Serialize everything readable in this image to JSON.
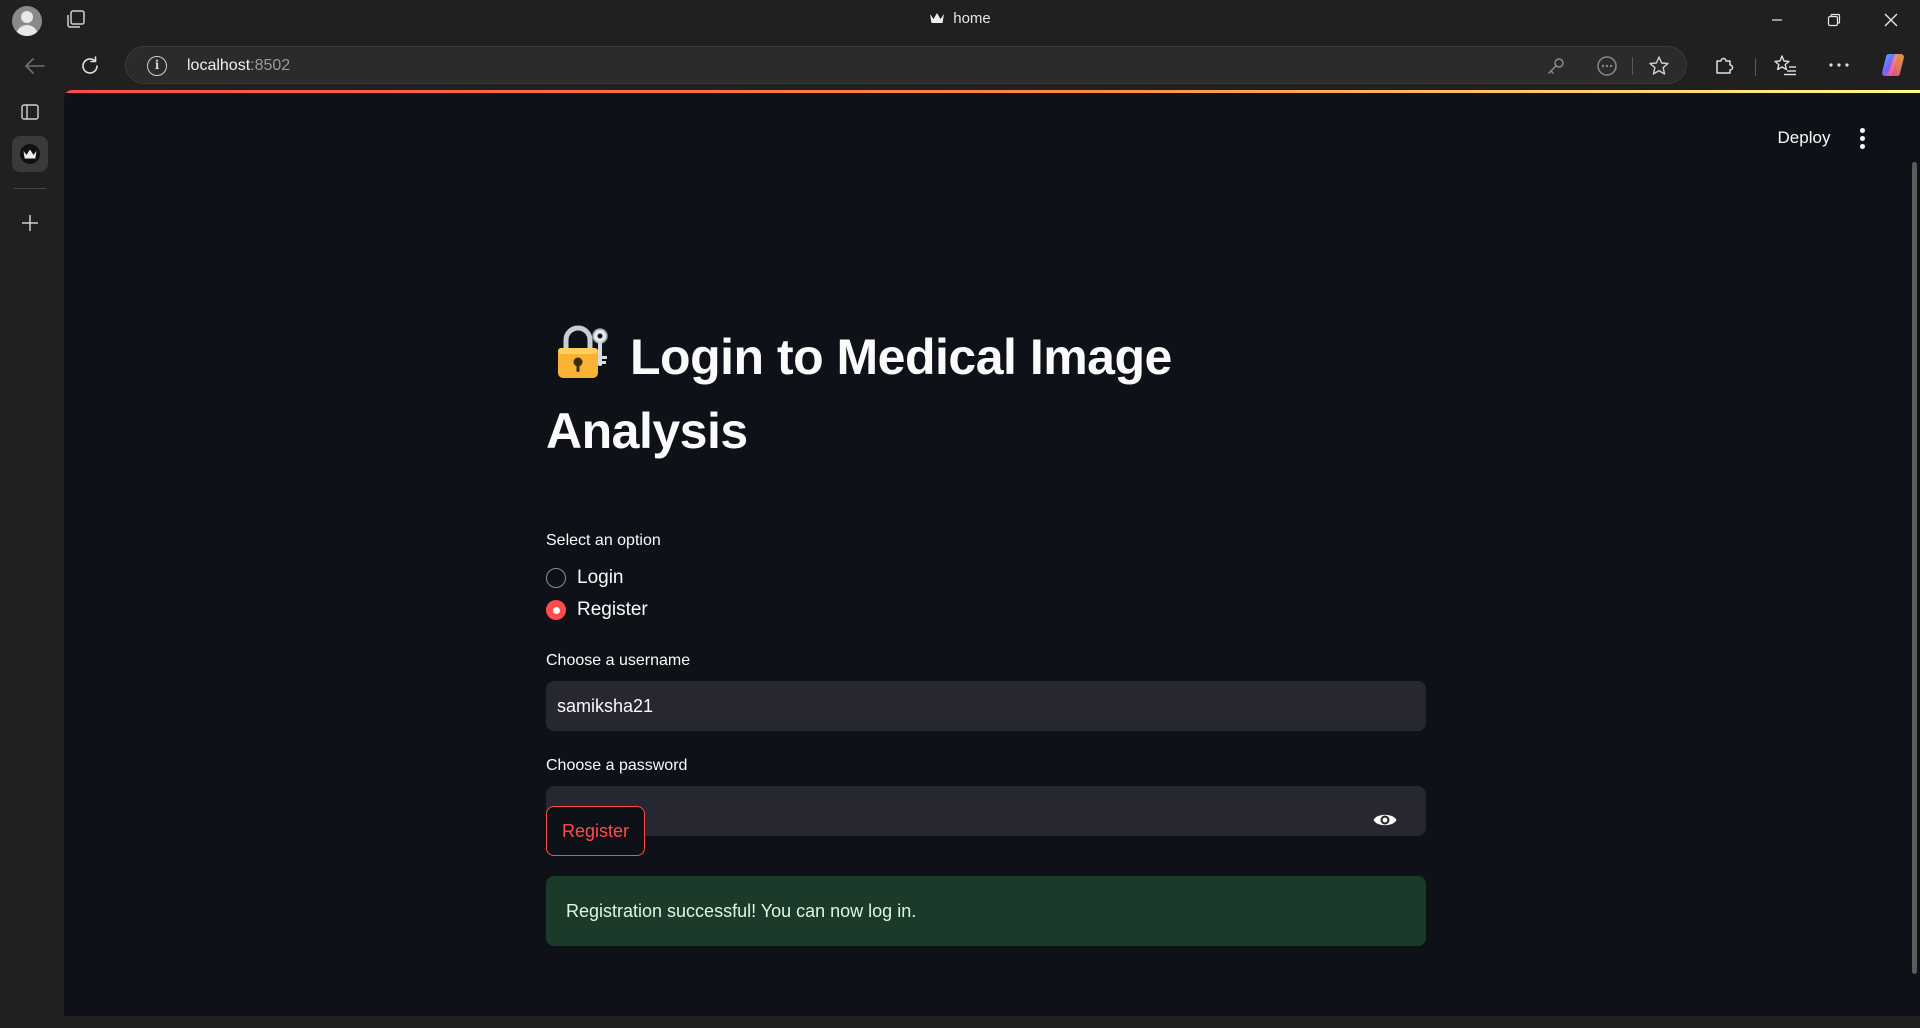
{
  "browser": {
    "tab_title": "home",
    "url_host": "localhost",
    "url_port": ":8502"
  },
  "app": {
    "deploy_label": "Deploy",
    "title": "Login to Medical Image Analysis",
    "radio": {
      "label": "Select an option",
      "options": [
        "Login",
        "Register"
      ],
      "selected": "Register"
    },
    "username": {
      "label": "Choose a username",
      "value": "samiksha21"
    },
    "password": {
      "label": "Choose a password",
      "value": "••••••••••"
    },
    "submit_label": "Register",
    "success_message": "Registration successful! You can now log in."
  },
  "colors": {
    "accent": "#ff4b4b",
    "background": "#0e1117",
    "input_bg": "#262730",
    "success_bg": "#1b3a2a"
  }
}
